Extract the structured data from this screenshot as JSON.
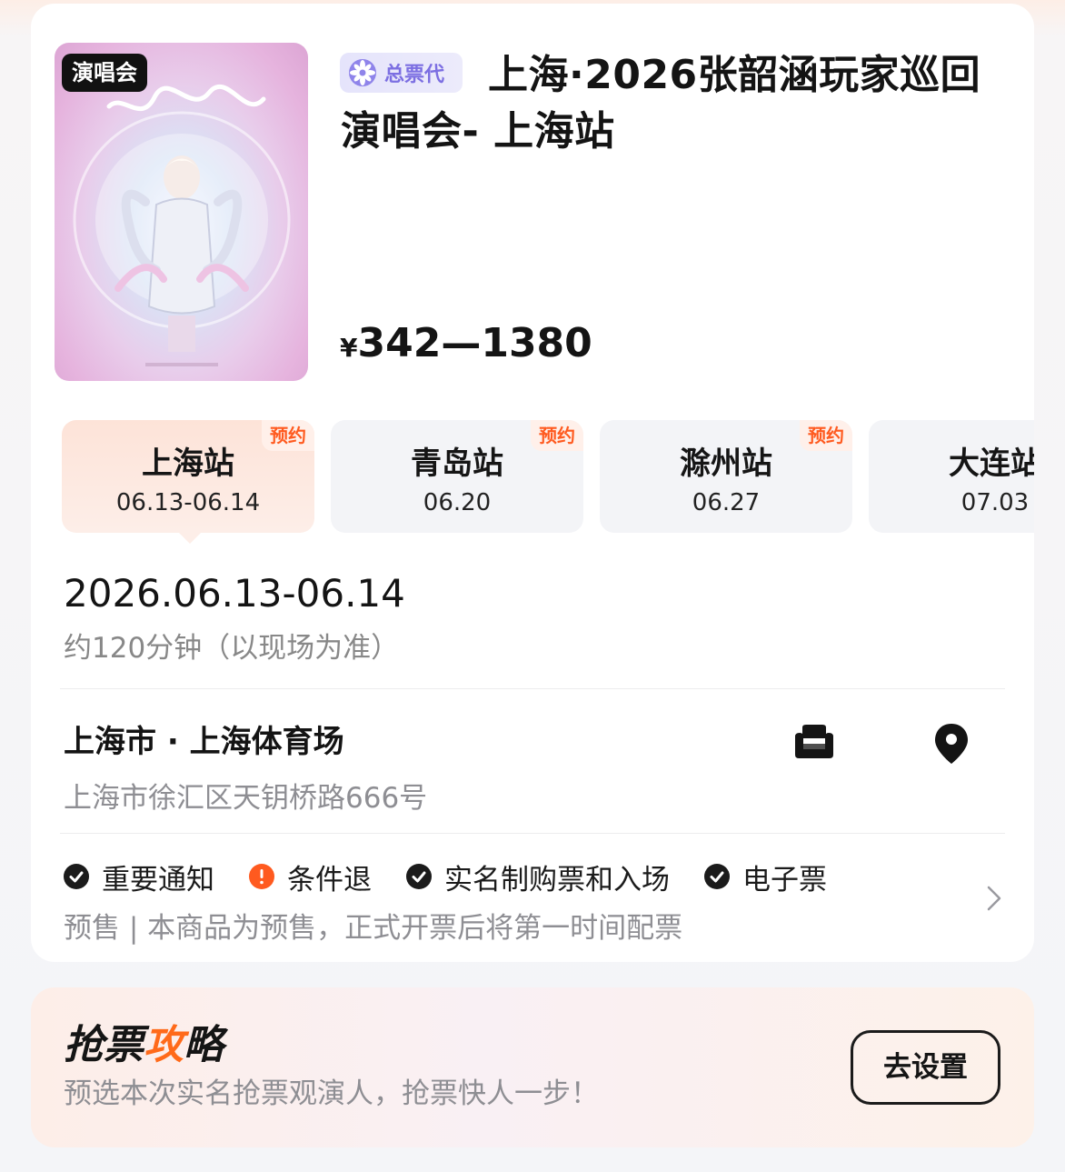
{
  "event": {
    "poster_badge": "演唱会",
    "agent_badge": "总票代",
    "title": "上海·2026张韶涵玩家巡回演唱会- 上海站",
    "price_currency": "¥",
    "price_range": "342—1380"
  },
  "stations": [
    {
      "name": "上海站",
      "date": "06.13-06.14",
      "badge": "预约",
      "active": true
    },
    {
      "name": "青岛站",
      "date": "06.20",
      "badge": "预约",
      "active": false
    },
    {
      "name": "滁州站",
      "date": "06.27",
      "badge": "预约",
      "active": false
    },
    {
      "name": "大连站",
      "date": "07.03",
      "badge": "",
      "active": false
    }
  ],
  "schedule": {
    "dates": "2026.06.13-06.14",
    "duration": "约120分钟（以现场为准）"
  },
  "venue": {
    "name": "上海市 · 上海体育场",
    "address": "上海市徐汇区天钥桥路666号",
    "seat_icon": "armchair-icon",
    "map_icon": "map-pin-icon"
  },
  "policies": [
    {
      "label": "重要通知",
      "icon": "check-circle-icon",
      "color": "#1b1b1b"
    },
    {
      "label": "条件退",
      "icon": "exclamation-circle-icon",
      "color": "#ff5a1f"
    },
    {
      "label": "实名制购票和入场",
      "icon": "check-circle-icon",
      "color": "#1b1b1b"
    },
    {
      "label": "电子票",
      "icon": "check-circle-icon",
      "color": "#1b1b1b"
    }
  ],
  "presale_note": "预售 | 本商品为预售，正式开票后将第一时间配票",
  "strategy": {
    "title_a": "抢票",
    "title_b": "攻",
    "title_c": "略",
    "subtitle": "预选本次实名抢票观演人，抢票快人一步！",
    "button": "去设置"
  },
  "colors": {
    "accent": "#ff5a1f",
    "agent_purple": "#7c6fe2"
  }
}
